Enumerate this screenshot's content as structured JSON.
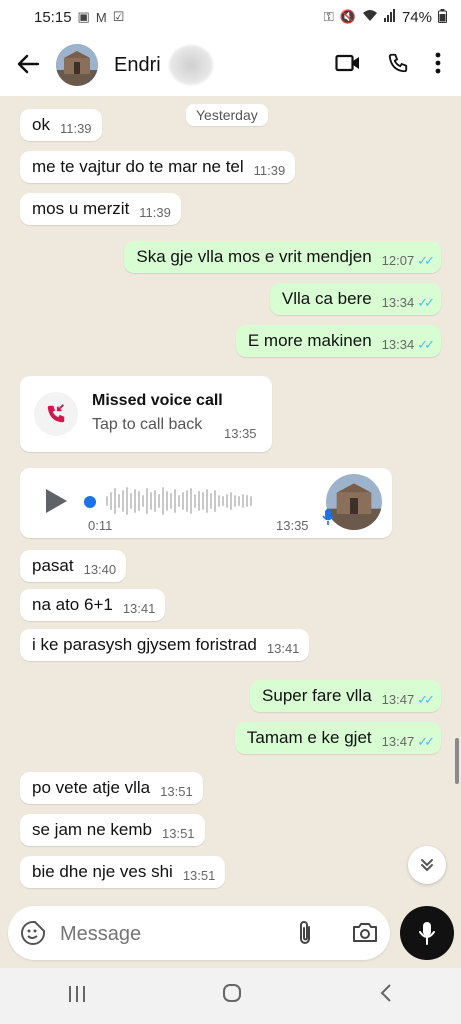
{
  "status": {
    "time": "15:15",
    "battery": "74%"
  },
  "header": {
    "contact_name": "Endri"
  },
  "chat": {
    "date_divider": "Yesterday",
    "messages": [
      {
        "dir": "in",
        "text": "ok",
        "time": "11:39"
      },
      {
        "dir": "in",
        "text": "me te vajtur do te mar ne tel",
        "time": "11:39"
      },
      {
        "dir": "in",
        "text": "mos u merzit",
        "time": "11:39"
      },
      {
        "dir": "out",
        "text": "Ska gje vlla mos e vrit mendjen",
        "time": "12:07"
      },
      {
        "dir": "out",
        "text": "Vlla ca bere",
        "time": "13:34"
      },
      {
        "dir": "out",
        "text": "E more makinen",
        "time": "13:34"
      }
    ],
    "missed_call": {
      "title": "Missed voice call",
      "subtitle": "Tap to call back",
      "time": "13:35"
    },
    "voice_note": {
      "duration": "0:11",
      "time": "13:35",
      "progress": 0
    },
    "messages2": [
      {
        "dir": "in",
        "text": "pasat",
        "time": "13:40"
      },
      {
        "dir": "in",
        "text": "na ato 6+1",
        "time": "13:41"
      },
      {
        "dir": "in",
        "text": "i ke parasysh gjysem foristrad",
        "time": "13:41"
      },
      {
        "dir": "out",
        "text": "Super fare vlla",
        "time": "13:47"
      },
      {
        "dir": "out",
        "text": "Tamam e ke gjet",
        "time": "13:47"
      },
      {
        "dir": "in",
        "text": "po vete atje vlla",
        "time": "13:51"
      },
      {
        "dir": "in",
        "text": "se jam ne kemb",
        "time": "13:51"
      },
      {
        "dir": "in",
        "text": "bie dhe nje ves shi",
        "time": "13:51"
      }
    ]
  },
  "composer": {
    "placeholder": "Message"
  },
  "colors": {
    "outgoing_bubble": "#d9fdd3",
    "incoming_bubble": "#ffffff",
    "read_ticks": "#53bdeb",
    "wallpaper": "#efe8dd"
  }
}
